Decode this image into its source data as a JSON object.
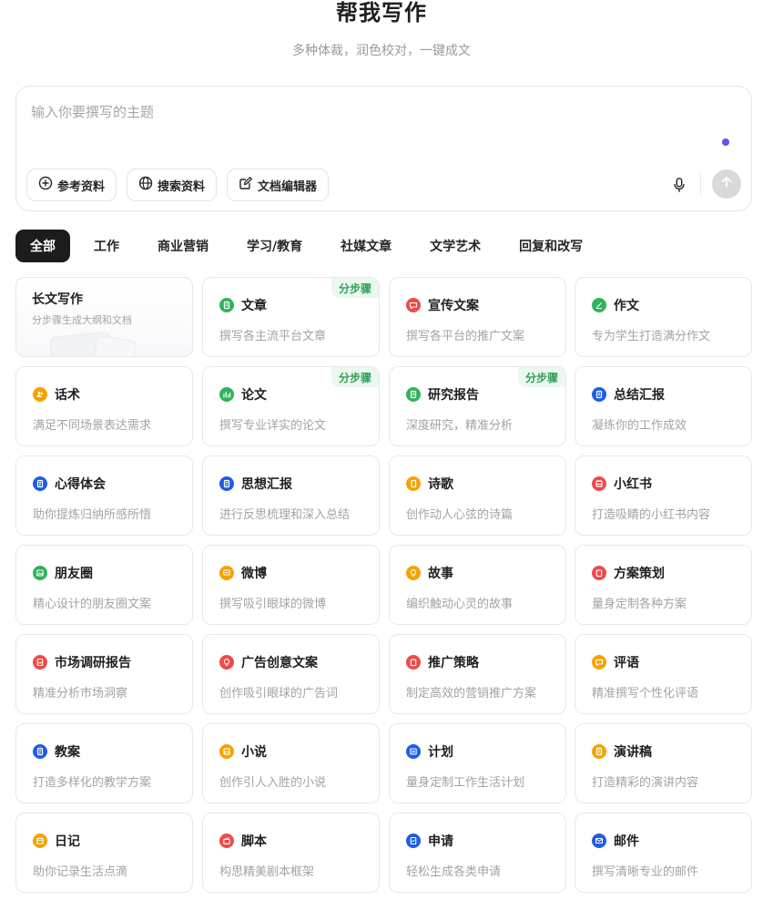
{
  "header": {
    "title": "帮我写作",
    "subtitle": "多种体裁，润色校对，一键成文"
  },
  "composer": {
    "placeholder": "输入你要撰写的主题",
    "value": "",
    "tools": [
      {
        "label": "参考资料",
        "icon": "plus-circle-icon"
      },
      {
        "label": "搜索资料",
        "icon": "globe-icon"
      },
      {
        "label": "文档编辑器",
        "icon": "edit-document-icon"
      }
    ],
    "mic_icon": "microphone-icon",
    "send_icon": "arrow-up-icon"
  },
  "tabs": [
    {
      "label": "全部",
      "active": true
    },
    {
      "label": "工作",
      "active": false
    },
    {
      "label": "商业营销",
      "active": false
    },
    {
      "label": "学习/教育",
      "active": false
    },
    {
      "label": "社媒文章",
      "active": false
    },
    {
      "label": "文学艺术",
      "active": false
    },
    {
      "label": "回复和改写",
      "active": false
    }
  ],
  "colors": {
    "green": "#2fb35b",
    "red": "#ef4a4a",
    "orange": "#f5a300",
    "blue": "#1f5ce8",
    "accent_dot": "#6a4ee6",
    "active_tab": "#1c1c1e",
    "badge_text": "#2f9e55"
  },
  "cards": [
    {
      "title": "长文写作",
      "desc": "分步骤生成大纲和文档",
      "icon": "",
      "color": "",
      "badge": "",
      "special": true
    },
    {
      "title": "文章",
      "desc": "撰写各主流平台文章",
      "icon": "document-icon",
      "color": "#2fb35b",
      "badge": "分步骤"
    },
    {
      "title": "宣传文案",
      "desc": "撰写各平台的推广文案",
      "icon": "chat-bubble-icon",
      "color": "#ef4a4a",
      "badge": ""
    },
    {
      "title": "作文",
      "desc": "专为学生打造满分作文",
      "icon": "pen-icon",
      "color": "#2fb35b",
      "badge": ""
    },
    {
      "title": "话术",
      "desc": "满足不同场景表达需求",
      "icon": "users-icon",
      "color": "#f5a300",
      "badge": ""
    },
    {
      "title": "论文",
      "desc": "撰写专业详实的论文",
      "icon": "bar-chart-icon",
      "color": "#2fb35b",
      "badge": "分步骤"
    },
    {
      "title": "研究报告",
      "desc": "深度研究，精准分析",
      "icon": "document-icon",
      "color": "#2fb35b",
      "badge": "分步骤"
    },
    {
      "title": "总结汇报",
      "desc": "凝练你的工作成效",
      "icon": "document-icon",
      "color": "#1f5ce8",
      "badge": ""
    },
    {
      "title": "心得体会",
      "desc": "助你提炼归纳所感所悟",
      "icon": "notebook-icon",
      "color": "#1f5ce8",
      "badge": ""
    },
    {
      "title": "思想汇报",
      "desc": "进行反思梳理和深入总结",
      "icon": "notebook-icon",
      "color": "#1f5ce8",
      "badge": ""
    },
    {
      "title": "诗歌",
      "desc": "创作动人心弦的诗篇",
      "icon": "scroll-icon",
      "color": "#f5a300",
      "badge": ""
    },
    {
      "title": "小红书",
      "desc": "打造吸睛的小红书内容",
      "icon": "book-icon",
      "color": "#ef4a4a",
      "badge": ""
    },
    {
      "title": "朋友圈",
      "desc": "精心设计的朋友圈文案",
      "icon": "image-icon",
      "color": "#2fb35b",
      "badge": ""
    },
    {
      "title": "微博",
      "desc": "撰写吸引眼球的微博",
      "icon": "message-icon",
      "color": "#f5a300",
      "badge": ""
    },
    {
      "title": "故事",
      "desc": "编织触动心灵的故事",
      "icon": "lightbulb-icon",
      "color": "#f5a300",
      "badge": ""
    },
    {
      "title": "方案策划",
      "desc": "量身定制各种方案",
      "icon": "clipboard-icon",
      "color": "#ef4a4a",
      "badge": ""
    },
    {
      "title": "市场调研报告",
      "desc": "精准分析市场洞察",
      "icon": "report-icon",
      "color": "#ef4a4a",
      "badge": ""
    },
    {
      "title": "广告创意文案",
      "desc": "创作吸引眼球的广告词",
      "icon": "lightbulb-icon",
      "color": "#ef4a4a",
      "badge": ""
    },
    {
      "title": "推广策略",
      "desc": "制定高效的营销推广方案",
      "icon": "clipboard-icon",
      "color": "#ef4a4a",
      "badge": ""
    },
    {
      "title": "评语",
      "desc": "精准撰写个性化评语",
      "icon": "chat-bubble-icon",
      "color": "#f5a300",
      "badge": ""
    },
    {
      "title": "教案",
      "desc": "打造多样化的教学方案",
      "icon": "notebook-icon",
      "color": "#1f5ce8",
      "badge": ""
    },
    {
      "title": "小说",
      "desc": "创作引人入胜的小说",
      "icon": "book-icon",
      "color": "#f5a300",
      "badge": ""
    },
    {
      "title": "计划",
      "desc": "量身定制工作生活计划",
      "icon": "calendar-list-icon",
      "color": "#1f5ce8",
      "badge": ""
    },
    {
      "title": "演讲稿",
      "desc": "打造精彩的演讲内容",
      "icon": "document-icon",
      "color": "#f5a300",
      "badge": ""
    },
    {
      "title": "日记",
      "desc": "助你记录生活点滴",
      "icon": "calendar-icon",
      "color": "#f5a300",
      "badge": ""
    },
    {
      "title": "脚本",
      "desc": "构思精美剧本框架",
      "icon": "clapperboard-icon",
      "color": "#ef4a4a",
      "badge": ""
    },
    {
      "title": "申请",
      "desc": "轻松生成各类申请",
      "icon": "form-icon",
      "color": "#1f5ce8",
      "badge": ""
    },
    {
      "title": "邮件",
      "desc": "撰写清晰专业的邮件",
      "icon": "mail-icon",
      "color": "#1f5ce8",
      "badge": ""
    }
  ]
}
